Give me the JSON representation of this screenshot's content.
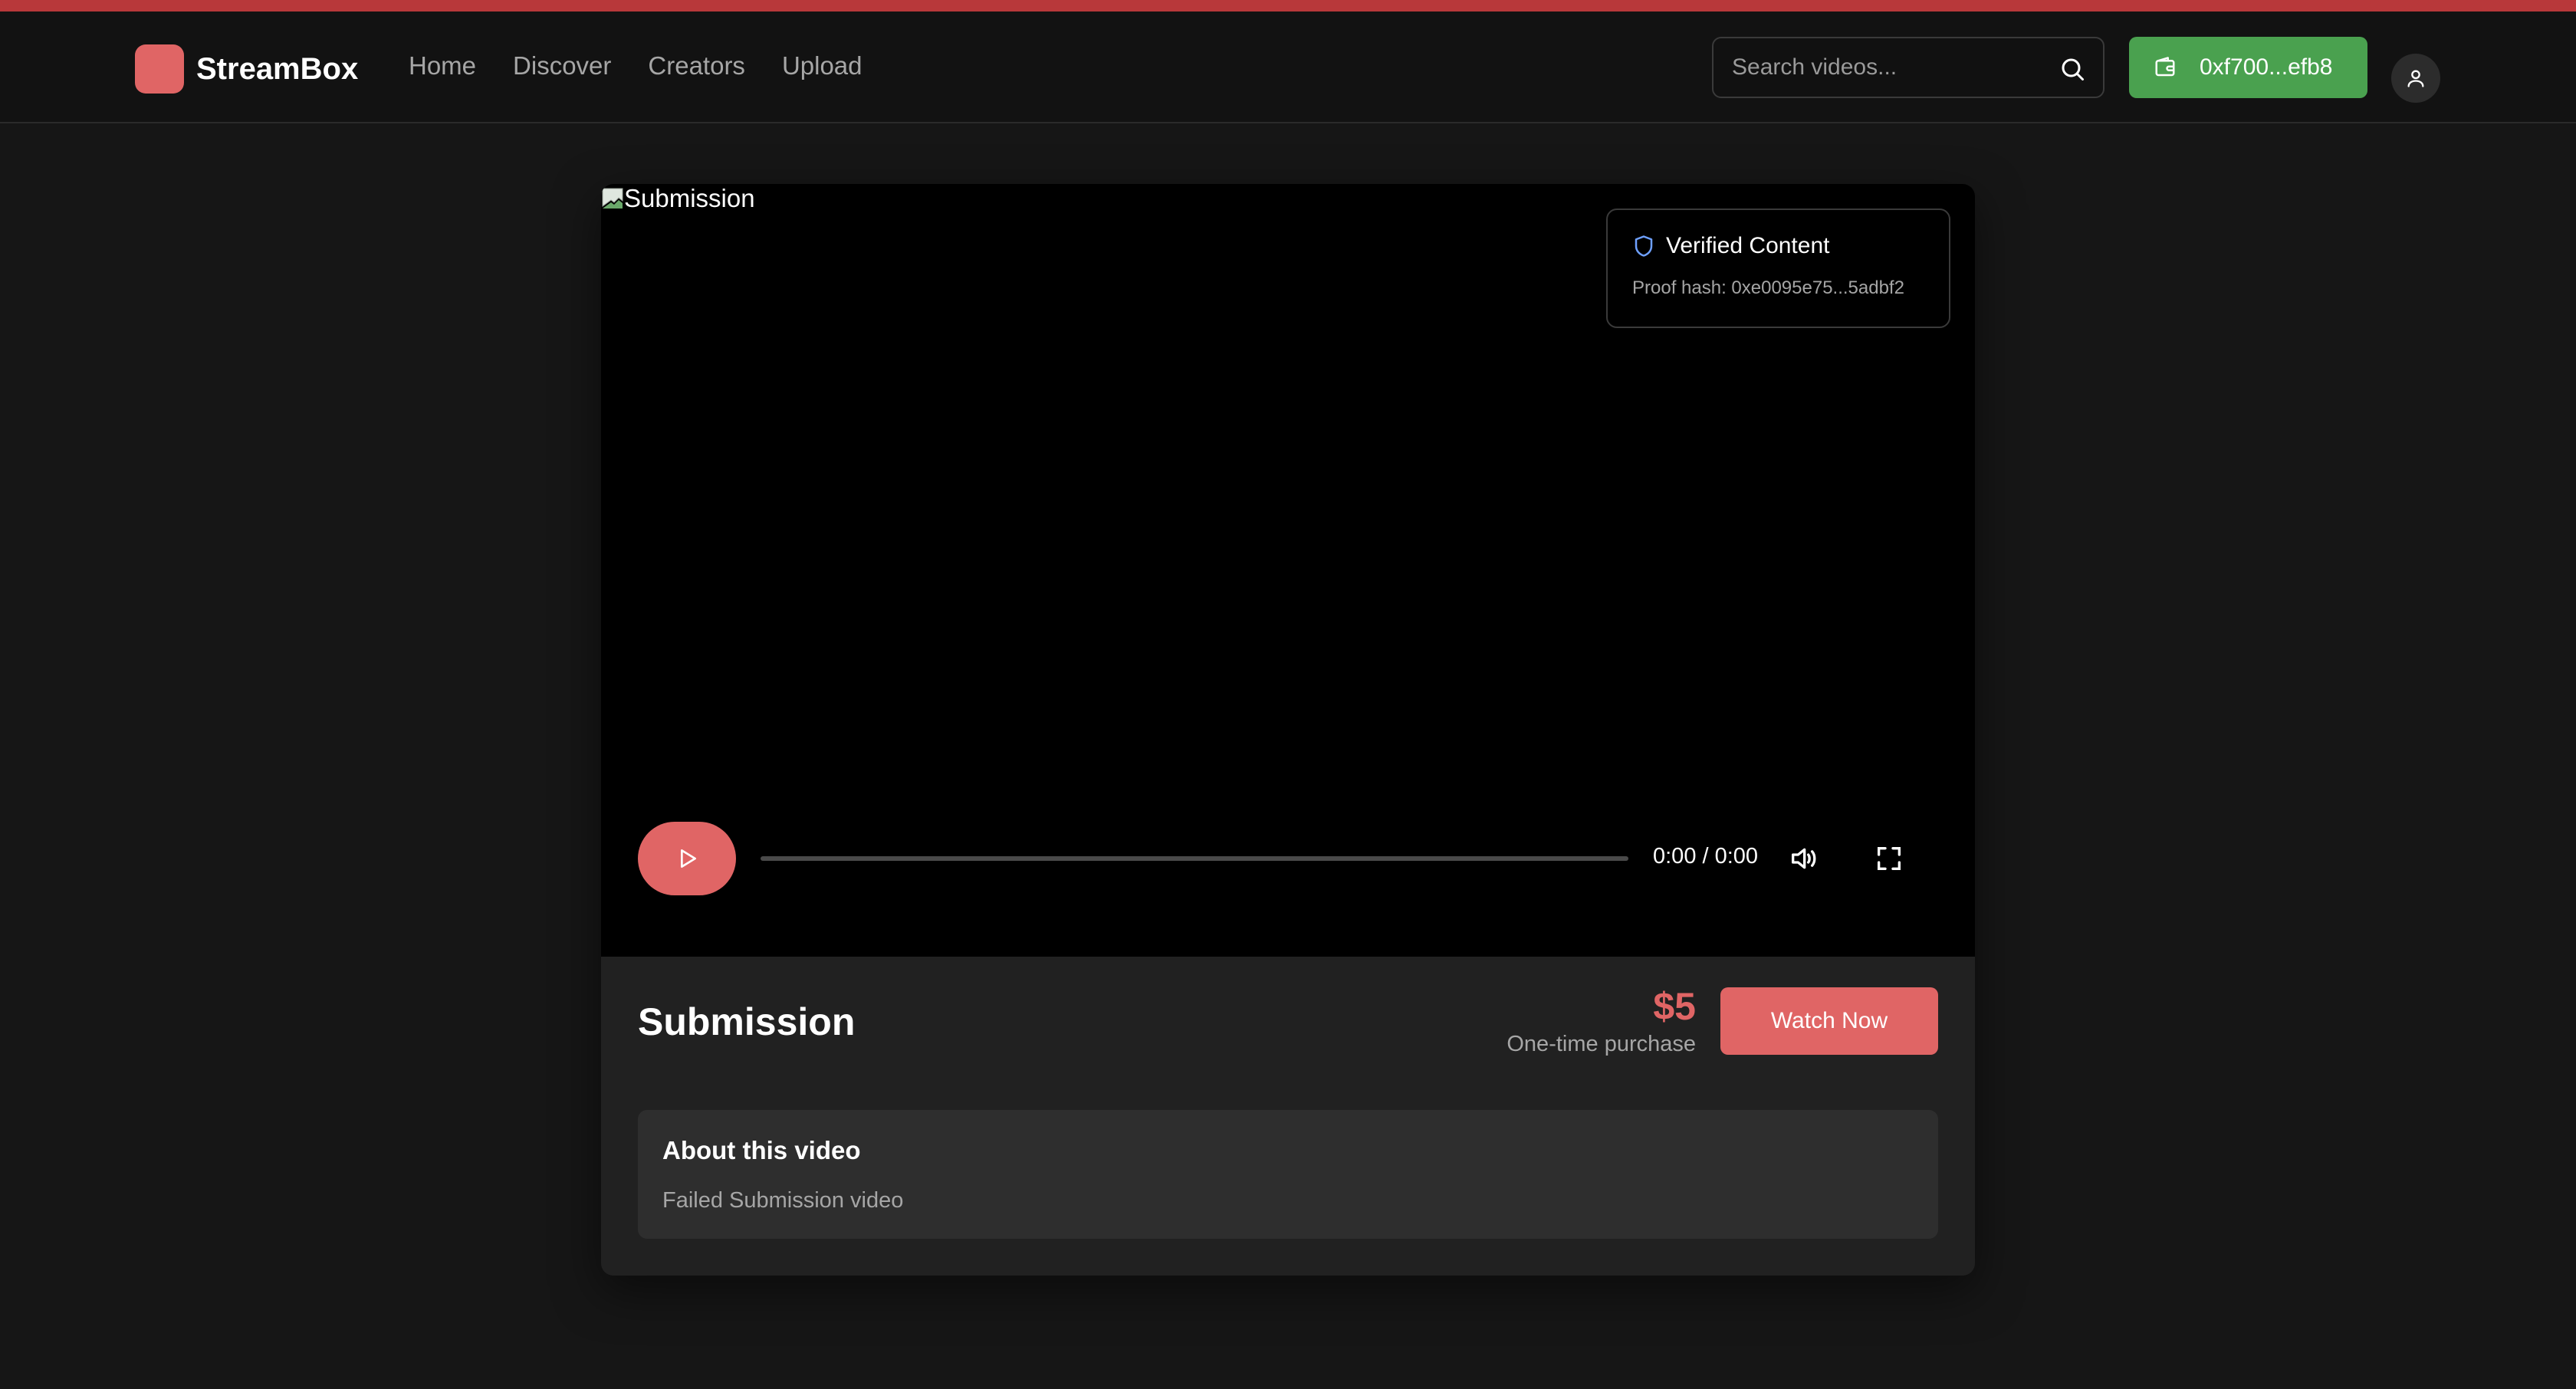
{
  "app": {
    "name": "StreamBox",
    "accent": "#e06565"
  },
  "nav": {
    "items": [
      "Home",
      "Discover",
      "Creators",
      "Upload"
    ]
  },
  "search": {
    "placeholder": "Search videos...",
    "value": ""
  },
  "wallet": {
    "address": "0xf700...efb8",
    "color": "#4aa14f"
  },
  "player": {
    "image_alt": "Submission",
    "verified": {
      "title": "Verified Content",
      "proof": "Proof hash: 0xe0095e75...5adbf2"
    },
    "time": "0:00 / 0:00",
    "progress": 0
  },
  "video": {
    "title": "Submission",
    "price": "$5",
    "price_note": "One-time purchase",
    "cta": "Watch Now",
    "about_title": "About this video",
    "about_text": "Failed Submission video"
  },
  "icons": [
    "logo-mark",
    "search-icon",
    "wallet-icon",
    "user-icon",
    "shield-icon",
    "play-icon",
    "volume-icon",
    "fullscreen-icon",
    "broken-image-icon"
  ]
}
